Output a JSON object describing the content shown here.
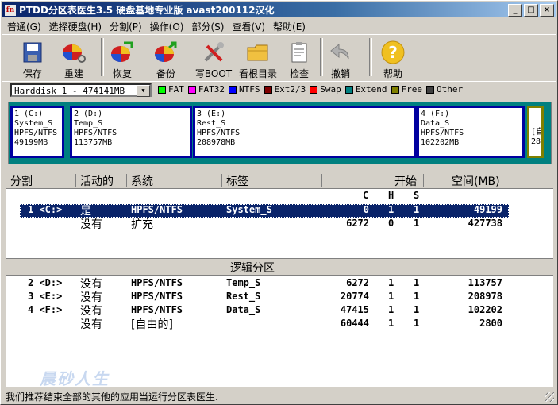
{
  "window": {
    "title": "PTDD分区表医生3.5 硬盘基地专业版 avast200112汉化",
    "icon_text": "fn"
  },
  "window_buttons": {
    "minimize": "_",
    "maximize": "□",
    "close": "×"
  },
  "menu": [
    "普通(G)",
    "选择硬盘(H)",
    "分割(P)",
    "操作(O)",
    "部分(S)",
    "查看(V)",
    "帮助(E)"
  ],
  "toolbar": {
    "save": "保存",
    "rebuild": "重建",
    "restore": "恢复",
    "backup": "备份",
    "writeboot": "写BOOT",
    "viewroot": "看根目录",
    "check": "检查",
    "undo": "撤销",
    "help": "帮助"
  },
  "disk": {
    "selected": "Harddisk 1 - 474141MB"
  },
  "legend": [
    {
      "label": "FAT",
      "color": "#00ff00"
    },
    {
      "label": "FAT32",
      "color": "#ff00ff"
    },
    {
      "label": "NTFS",
      "color": "#0000ff"
    },
    {
      "label": "Ext2/3",
      "color": "#800000"
    },
    {
      "label": "Swap",
      "color": "#ff0000"
    },
    {
      "label": "Extend",
      "color": "#008080"
    },
    {
      "label": "Free",
      "color": "#808000"
    },
    {
      "label": "Other",
      "color": "#404040"
    }
  ],
  "partmap": {
    "p1": {
      "line1": "1 (C:)",
      "line2": "System_S",
      "line3": "HPFS/NTFS",
      "line4": "49199MB"
    },
    "p2": {
      "line1": "2 (D:)",
      "line2": "Temp_S",
      "line3": "HPFS/NTFS",
      "line4": "113757MB"
    },
    "p3": {
      "line1": "3 (E:)",
      "line2": "Rest_S",
      "line3": "HPFS/NTFS",
      "line4": "208978MB"
    },
    "p4": {
      "line1": "4 (F:)",
      "line2": "Data_S",
      "line3": "HPFS/NTFS",
      "line4": "102202MB"
    },
    "p5": {
      "line1": "[自",
      "line2": "280"
    }
  },
  "columns": {
    "partition": "分割",
    "active": "活动的",
    "system": "系统",
    "label": "标签",
    "start": "开始",
    "size": "空间(MB)",
    "c": "C",
    "h": "H",
    "s": "S"
  },
  "primary_rows": [
    {
      "num": "1 <C:>",
      "active": "是",
      "system": "HPFS/NTFS",
      "label": "System_S",
      "c": "0",
      "h": "1",
      "s": "1",
      "size": "49199"
    },
    {
      "num": "",
      "active": "没有",
      "system": "扩充",
      "label": "",
      "c": "6272",
      "h": "0",
      "s": "1",
      "size": "427738"
    }
  ],
  "logical_band": "逻辑分区",
  "logical_rows": [
    {
      "num": "2 <D:>",
      "active": "没有",
      "system": "HPFS/NTFS",
      "label": "Temp_S",
      "c": "6272",
      "h": "1",
      "s": "1",
      "size": "113757"
    },
    {
      "num": "3 <E:>",
      "active": "没有",
      "system": "HPFS/NTFS",
      "label": "Rest_S",
      "c": "20774",
      "h": "1",
      "s": "1",
      "size": "208978"
    },
    {
      "num": "4 <F:>",
      "active": "没有",
      "system": "HPFS/NTFS",
      "label": "Data_S",
      "c": "47415",
      "h": "1",
      "s": "1",
      "size": "102202"
    },
    {
      "num": "",
      "active": "没有",
      "system": "[自由的]",
      "label": "",
      "c": "60444",
      "h": "1",
      "s": "1",
      "size": "2800"
    }
  ],
  "watermark": "晨砂人生",
  "status": "我们推荐结束全部的其他的应用当运行分区表医生."
}
